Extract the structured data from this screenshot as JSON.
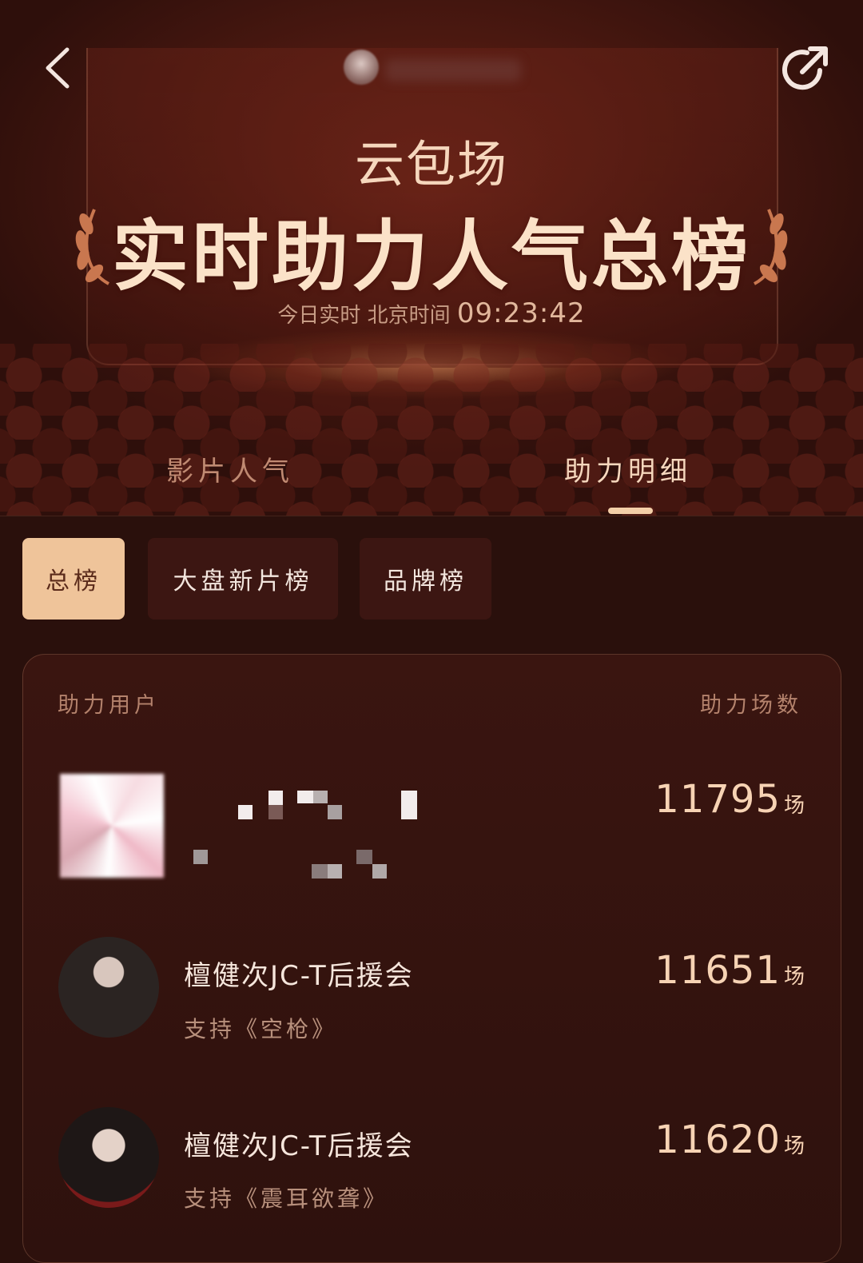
{
  "header": {
    "subtitle": "云包场",
    "title": "实时助力人气总榜",
    "realtime_label": "今日实时 北京时间",
    "realtime_time": "09:23:42"
  },
  "tabs": [
    {
      "label": "影片人气",
      "active": false
    },
    {
      "label": "助力明细",
      "active": true
    }
  ],
  "filters": [
    {
      "label": "总榜",
      "selected": true
    },
    {
      "label": "大盘新片榜",
      "selected": false
    },
    {
      "label": "品牌榜",
      "selected": false
    }
  ],
  "table": {
    "col_user": "助力用户",
    "col_count": "助力场数",
    "unit": "场",
    "rows": [
      {
        "name": "",
        "support": "",
        "count": "11795",
        "avatar": "blurred-avatar"
      },
      {
        "name": "檀健次JC-T后援会",
        "support": "支持《空枪》",
        "count": "11651",
        "avatar": "fan-club-avatar"
      },
      {
        "name": "檀健次JC-T后援会",
        "support": "支持《震耳欲聋》",
        "count": "11620",
        "avatar": "fan-club-avatar"
      }
    ]
  },
  "icons": {
    "back": "chevron-left-icon",
    "share": "share-icon",
    "laurel": "laurel-icon"
  },
  "colors": {
    "accent": "#efc49a",
    "background": "#2a100c",
    "count_text": "#f7d3b4"
  }
}
